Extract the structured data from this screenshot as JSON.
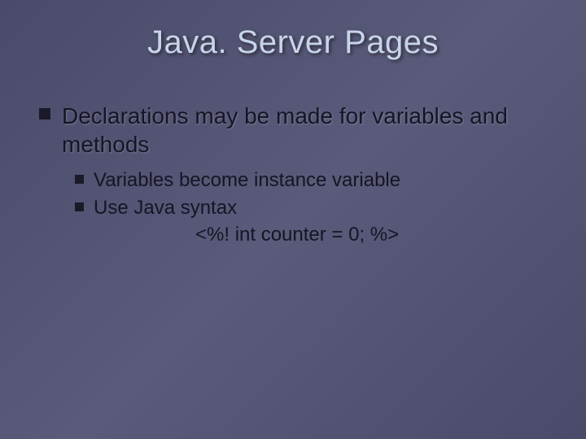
{
  "title": "Java. Server Pages",
  "main_bullet": "Declarations may be made for variables and methods",
  "sub_bullets": [
    "Variables become instance variable",
    "Use Java syntax"
  ],
  "code_example": "<%!  int counter = 0;  %>"
}
